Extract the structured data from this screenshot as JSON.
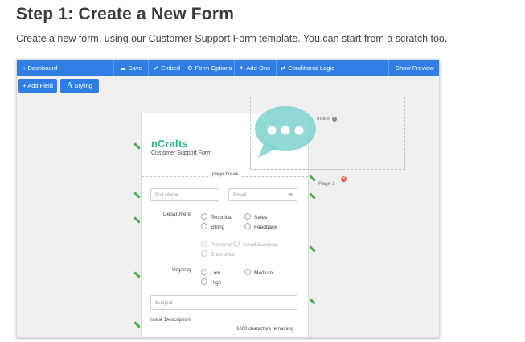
{
  "heading": "Step 1: Create a New Form",
  "intro": "Create a new form, using our Customer Support Form template. You can start from a scratch too.",
  "toolbar": {
    "back": "Dashboard",
    "save": "Save",
    "embed": "Embed",
    "form_options": "Form Options",
    "addons": "Add-Ons",
    "conditional_logic": "Conditional Logic",
    "show_preview": "Show Preview"
  },
  "editor": {
    "add_field": "Add Field",
    "styling": "Styling",
    "index_label": "Index",
    "page_label": "Page 1"
  },
  "form": {
    "brand": "nCrafts",
    "subtitle": "Customer Support Form",
    "page_break": "page break",
    "fullname_placeholder": "Full Name",
    "email_placeholder": "Email",
    "department_label": "Department",
    "department_options": [
      "Technical",
      "Sales",
      "Billing",
      "Feedback"
    ],
    "dim_options": [
      "Personal",
      "Small Business",
      "Enterprise"
    ],
    "urgency_label": "Urgency",
    "urgency_options": [
      "Low",
      "Medium",
      "High"
    ],
    "subject_placeholder": "Subject",
    "issue_label": "Issue Description",
    "chars_remaining": "1000 characters remaining"
  },
  "colors": {
    "toolbar": "#2f7ee4",
    "brand": "#2bb38a",
    "bubble": "#7ed2cf",
    "pencil": "#4caf50",
    "close": "#e85d5d"
  },
  "icons": [
    "chevron-left-icon",
    "cloud-save-icon",
    "check-circle-icon",
    "gear-icon",
    "puzzle-icon",
    "shuffle-icon",
    "plus-icon",
    "font-a-icon",
    "envelope-icon",
    "pencil-icon",
    "close-icon",
    "speech-bubble-icon",
    "help-icon"
  ]
}
